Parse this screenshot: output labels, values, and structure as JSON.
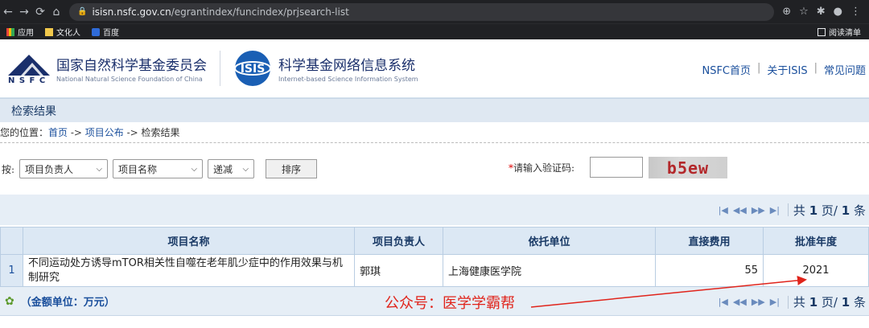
{
  "browser": {
    "url_host": "isisn.nsfc.gov.cn",
    "url_path": "/egrantindex/funcindex/prjsearch-list",
    "bookmarks": [
      "应用",
      "文化人",
      "百度"
    ],
    "reading_list": "阅读清单"
  },
  "header": {
    "org_cn": "国家自然科学基金委员会",
    "org_en": "National Natural Science Foundation of China",
    "nsfc_abbr": "N S F C",
    "isis_logo": "ISIS",
    "sys_cn": "科学基金网络信息系统",
    "sys_en": "Internet-based Science Information System",
    "links": [
      "NSFC首页",
      "关于ISIS",
      "常见问题"
    ]
  },
  "page_title": "检索结果",
  "location": {
    "prefix": "您的位置：",
    "home": "首页",
    "arrow1": " -> ",
    "projects": "项目公布",
    "arrow2": " -> ",
    "current": "检索结果"
  },
  "filter": {
    "by_label": "按:",
    "sort_field1": "项目负责人",
    "sort_field2": "项目名称",
    "order": "递减",
    "sort_button": "排序",
    "captcha_label": "请输入验证码:",
    "captcha_text": "b5ew"
  },
  "pager": {
    "total_prefix": "共",
    "pages": "1",
    "page_unit": "页/",
    "records": "1",
    "record_unit": "条"
  },
  "table": {
    "headers": [
      "项目名称",
      "项目负责人",
      "依托单位",
      "直接费用",
      "批准年度"
    ],
    "rows": [
      {
        "index": "1",
        "name": "不同运动处方诱导mTOR相关性自噬在老年肌少症中的作用效果与机制研究",
        "leader": "郭琪",
        "institution": "上海健康医学院",
        "funding": "55",
        "year": "2021"
      }
    ]
  },
  "footer": {
    "unit": "（金额单位：万元）",
    "watermark": "公众号：医学学霸帮"
  }
}
